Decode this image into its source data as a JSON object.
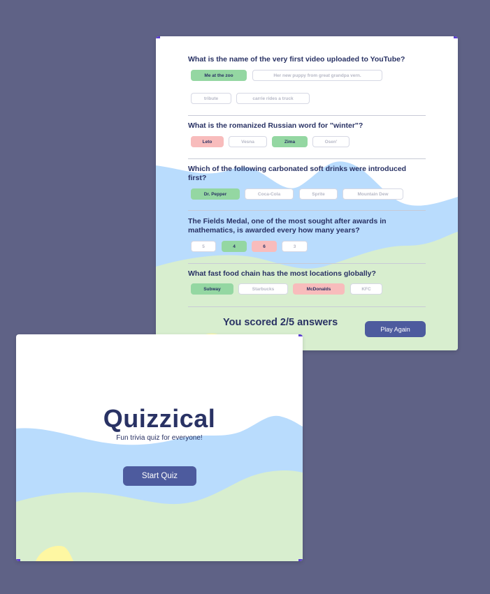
{
  "colors": {
    "page_bg": "#5f6286",
    "card_bg": "#ffffff",
    "text_dark": "#293264",
    "button_bg": "#4d5b9e",
    "correct": "#94d7a2",
    "wrong": "#f8bcbc",
    "blob_blue": "#b9dcfd",
    "blob_green": "#d8eecf",
    "blob_yellow": "#fef7a2"
  },
  "quiz": {
    "questions": [
      {
        "question": "What is the name of the very first video uploaded to YouTube?",
        "answers": [
          {
            "label": "Me at the zoo",
            "state": "correct"
          },
          {
            "label": "Her new puppy from great grandpa vern.",
            "state": "default"
          },
          {
            "label": "tribute",
            "state": "default"
          },
          {
            "label": "carrie rides a truck",
            "state": "default"
          }
        ]
      },
      {
        "question": "What is the romanized Russian word for \"winter\"?",
        "answers": [
          {
            "label": "Leto",
            "state": "wrong"
          },
          {
            "label": "Vesna",
            "state": "default"
          },
          {
            "label": "Zima",
            "state": "correct"
          },
          {
            "label": "Osen'",
            "state": "default"
          }
        ]
      },
      {
        "question": "Which of the following carbonated soft drinks were introduced first?",
        "answers": [
          {
            "label": "Dr. Pepper",
            "state": "correct"
          },
          {
            "label": "Coca-Cola",
            "state": "default"
          },
          {
            "label": "Sprite",
            "state": "default"
          },
          {
            "label": "Mountain Dew",
            "state": "default"
          }
        ]
      },
      {
        "question": "The Fields Medal, one of the most sought after awards in mathematics, is awarded every how many years?",
        "answers": [
          {
            "label": "5",
            "state": "default"
          },
          {
            "label": "4",
            "state": "correct"
          },
          {
            "label": "6",
            "state": "wrong"
          },
          {
            "label": "3",
            "state": "default"
          }
        ]
      },
      {
        "question": "What fast food chain has the most locations globally?",
        "answers": [
          {
            "label": "Subway",
            "state": "correct"
          },
          {
            "label": "Starbucks",
            "state": "default"
          },
          {
            "label": "McDonalds",
            "state": "wrong"
          },
          {
            "label": "KFC",
            "state": "default"
          }
        ]
      }
    ],
    "score_text": "You scored 2/5 answers",
    "play_again_label": "Play Again"
  },
  "intro": {
    "title": "Quizzical",
    "subtitle": "Fun trivia quiz for everyone!",
    "start_label": "Start Quiz"
  }
}
